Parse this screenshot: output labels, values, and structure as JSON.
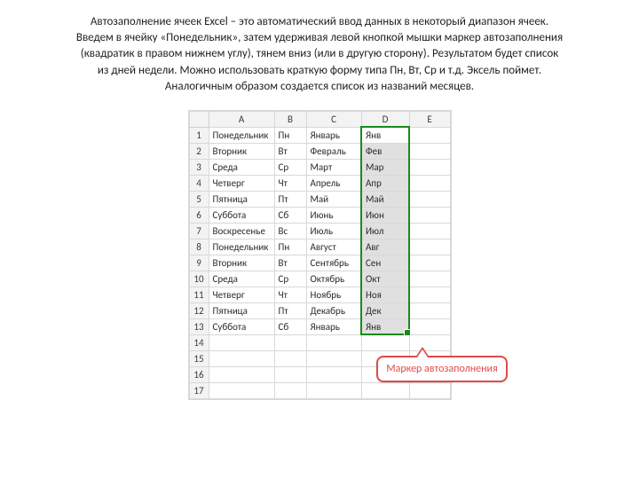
{
  "description": {
    "l1": "Автозаполнение ячеек Excel – это автоматический ввод  данных в некоторый диапазон ячеек.",
    "l2": "Введем в ячейку «Понедельник», затем удерживая левой кнопкой мышки маркер автозаполнения",
    "l3": "(квадратик в правом нижнем углу), тянем вниз (или в другую сторону). Результатом будет список",
    "l4": "из дней недели. Можно использовать краткую форму типа Пн, Вт, Ср и т.д. Эксель поймет.",
    "l5": "Аналогичным образом создается список из названий месяцев."
  },
  "cols": {
    "A": "A",
    "B": "B",
    "C": "C",
    "D": "D",
    "E": "E"
  },
  "rows": [
    {
      "n": "1",
      "A": "Понедельник",
      "B": "Пн",
      "C": "Январь",
      "D": "Янв"
    },
    {
      "n": "2",
      "A": "Вторник",
      "B": "Вт",
      "C": "Февраль",
      "D": "Фев"
    },
    {
      "n": "3",
      "A": "Среда",
      "B": "Ср",
      "C": "Март",
      "D": "Мар"
    },
    {
      "n": "4",
      "A": "Четверг",
      "B": "Чт",
      "C": "Апрель",
      "D": "Апр"
    },
    {
      "n": "5",
      "A": "Пятница",
      "B": "Пт",
      "C": "Май",
      "D": "Май"
    },
    {
      "n": "6",
      "A": "Суббота",
      "B": "Сб",
      "C": "Июнь",
      "D": "Июн"
    },
    {
      "n": "7",
      "A": "Воскресенье",
      "B": "Вс",
      "C": "Июль",
      "D": "Июл"
    },
    {
      "n": "8",
      "A": "Понедельник",
      "B": "Пн",
      "C": "Август",
      "D": "Авг"
    },
    {
      "n": "9",
      "A": "Вторник",
      "B": "Вт",
      "C": "Сентябрь",
      "D": "Сен"
    },
    {
      "n": "10",
      "A": "Среда",
      "B": "Ср",
      "C": "Октябрь",
      "D": "Окт"
    },
    {
      "n": "11",
      "A": "Четверг",
      "B": "Чт",
      "C": "Ноябрь",
      "D": "Ноя"
    },
    {
      "n": "12",
      "A": "Пятница",
      "B": "Пт",
      "C": "Декабрь",
      "D": "Дек"
    },
    {
      "n": "13",
      "A": "Суббота",
      "B": "Сб",
      "C": "Январь",
      "D": "Янв"
    },
    {
      "n": "14"
    },
    {
      "n": "15"
    },
    {
      "n": "16"
    },
    {
      "n": "17"
    }
  ],
  "callout": "Маркер автозаполнения"
}
